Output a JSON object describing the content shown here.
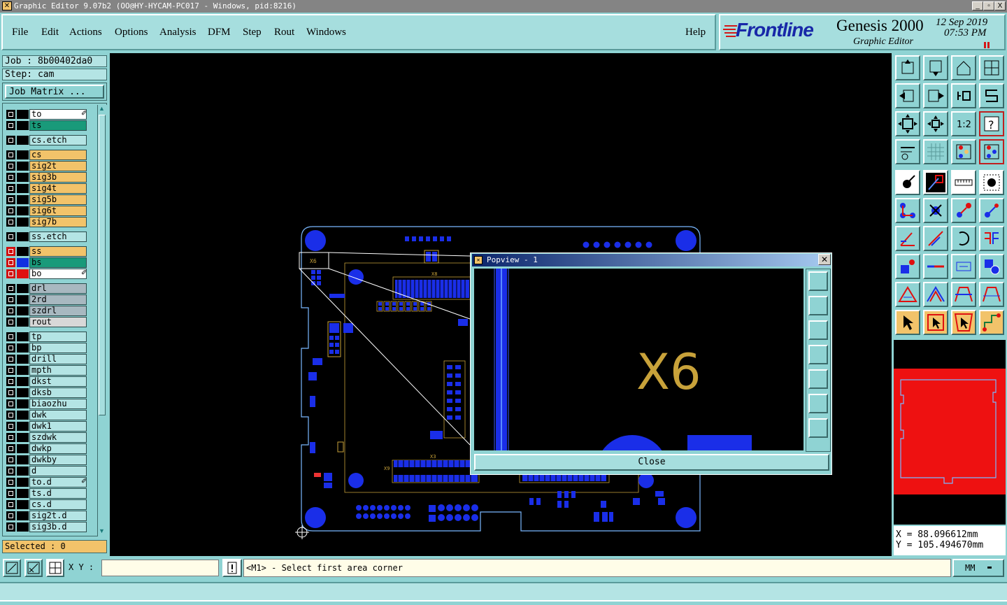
{
  "window": {
    "title": "Graphic Editor 9.07b2 (OO@HY-HYCAM-PC017 - Windows, pid:8216)",
    "minimize": "_",
    "maximize": "▫",
    "close": "X"
  },
  "menu": {
    "items": [
      "File",
      "Edit",
      "Actions",
      "Options",
      "Analysis",
      "DFM",
      "Step",
      "Rout",
      "Windows"
    ],
    "help": "Help"
  },
  "brand": {
    "logo": "Frontline",
    "product": "Genesis 2000",
    "subtitle": "Graphic Editor",
    "date": "12 Sep 2019",
    "time": "07:53 PM"
  },
  "job": {
    "job_label": "Job : 8b00402da0",
    "step_label": "Step: cam",
    "matrix_button": "Job Matrix ..."
  },
  "layers": [
    {
      "name": "to",
      "bg": "#ffffff",
      "sw": "#000000",
      "check": "#000000",
      "flag": true
    },
    {
      "name": "ts",
      "bg": "#199a7a",
      "sw": "#000000",
      "check": "#000000",
      "flag": false
    },
    {
      "name": "cs.etch",
      "bg": "#b4e4e4",
      "sw": "#000000",
      "check": "#000000",
      "flag": false
    },
    {
      "name": "cs",
      "bg": "#f2c36a",
      "sw": "#000000",
      "check": "#000000",
      "flag": false
    },
    {
      "name": "sig2t",
      "bg": "#f2c36a",
      "sw": "#000000",
      "check": "#000000",
      "flag": false
    },
    {
      "name": "sig3b",
      "bg": "#f2c36a",
      "sw": "#000000",
      "check": "#000000",
      "flag": false
    },
    {
      "name": "sig4t",
      "bg": "#f2c36a",
      "sw": "#000000",
      "check": "#000000",
      "flag": false
    },
    {
      "name": "sig5b",
      "bg": "#f2c36a",
      "sw": "#000000",
      "check": "#000000",
      "flag": false
    },
    {
      "name": "sig6t",
      "bg": "#f2c36a",
      "sw": "#000000",
      "check": "#000000",
      "flag": false
    },
    {
      "name": "sig7b",
      "bg": "#f2c36a",
      "sw": "#000000",
      "check": "#000000",
      "flag": false
    },
    {
      "name": "ss.etch",
      "bg": "#b4e4e4",
      "sw": "#000000",
      "check": "#000000",
      "flag": false
    },
    {
      "name": "ss",
      "bg": "#f2c36a",
      "sw": "#000000",
      "check": "#d01010",
      "flag": false
    },
    {
      "name": "bs",
      "bg": "#199a7a",
      "sw": "#1030e0",
      "check": "#d01010",
      "flag": false
    },
    {
      "name": "bo",
      "bg": "#ffffff",
      "sw": "#e01010",
      "check": "#d01010",
      "flag": true
    },
    {
      "name": "drl",
      "bg": "#a8b8c0",
      "sw": "#000000",
      "check": "#000000",
      "flag": false
    },
    {
      "name": "2rd",
      "bg": "#a8b8c0",
      "sw": "#000000",
      "check": "#000000",
      "flag": false
    },
    {
      "name": "szdrl",
      "bg": "#a8b8c0",
      "sw": "#000000",
      "check": "#000000",
      "flag": false
    },
    {
      "name": "rout",
      "bg": "#d8d8d8",
      "sw": "#000000",
      "check": "#000000",
      "flag": false
    },
    {
      "name": "tp",
      "bg": "#b4e4e4",
      "sw": "#000000",
      "check": "#000000",
      "flag": false
    },
    {
      "name": "bp",
      "bg": "#b4e4e4",
      "sw": "#000000",
      "check": "#000000",
      "flag": false
    },
    {
      "name": "drill",
      "bg": "#b4e4e4",
      "sw": "#000000",
      "check": "#000000",
      "flag": false
    },
    {
      "name": "mpth",
      "bg": "#b4e4e4",
      "sw": "#000000",
      "check": "#000000",
      "flag": false
    },
    {
      "name": "dkst",
      "bg": "#b4e4e4",
      "sw": "#000000",
      "check": "#000000",
      "flag": false
    },
    {
      "name": "dksb",
      "bg": "#b4e4e4",
      "sw": "#000000",
      "check": "#000000",
      "flag": false
    },
    {
      "name": "biaozhu",
      "bg": "#b4e4e4",
      "sw": "#000000",
      "check": "#000000",
      "flag": false
    },
    {
      "name": "dwk",
      "bg": "#b4e4e4",
      "sw": "#000000",
      "check": "#000000",
      "flag": false
    },
    {
      "name": "dwk1",
      "bg": "#b4e4e4",
      "sw": "#000000",
      "check": "#000000",
      "flag": false
    },
    {
      "name": "szdwk",
      "bg": "#b4e4e4",
      "sw": "#000000",
      "check": "#000000",
      "flag": false
    },
    {
      "name": "dwkp",
      "bg": "#b4e4e4",
      "sw": "#000000",
      "check": "#000000",
      "flag": false
    },
    {
      "name": "dwkby",
      "bg": "#b4e4e4",
      "sw": "#000000",
      "check": "#000000",
      "flag": false
    },
    {
      "name": "d",
      "bg": "#b4e4e4",
      "sw": "#000000",
      "check": "#000000",
      "flag": false
    },
    {
      "name": "to.d",
      "bg": "#b4e4e4",
      "sw": "#000000",
      "check": "#000000",
      "flag": true
    },
    {
      "name": "ts.d",
      "bg": "#b4e4e4",
      "sw": "#000000",
      "check": "#000000",
      "flag": false
    },
    {
      "name": "cs.d",
      "bg": "#b4e4e4",
      "sw": "#000000",
      "check": "#000000",
      "flag": false
    },
    {
      "name": "sig2t.d",
      "bg": "#b4e4e4",
      "sw": "#000000",
      "check": "#000000",
      "flag": false
    },
    {
      "name": "sig3b.d",
      "bg": "#b4e4e4",
      "sw": "#000000",
      "check": "#000000",
      "flag": false
    }
  ],
  "selected": "Selected : 0",
  "popview": {
    "title": "Popview - 1",
    "label": "X6",
    "close_button": "Close"
  },
  "board_labels": {
    "x6": "X6",
    "x8": "X8",
    "x3": "X3",
    "x9": "X9"
  },
  "coords": {
    "x": "X = 88.096612mm",
    "y": "Y = 105.494670mm"
  },
  "status": {
    "xy_label": "X Y :",
    "xy_value": "",
    "message": "<M1> - Select first area corner",
    "units": "MM"
  },
  "colors": {
    "panel": "#8fd3d3",
    "board_outline": "#7ab8ff",
    "copper": "#1a2ee8",
    "silk": "#c8a23a",
    "highlight": "#ee1111"
  }
}
